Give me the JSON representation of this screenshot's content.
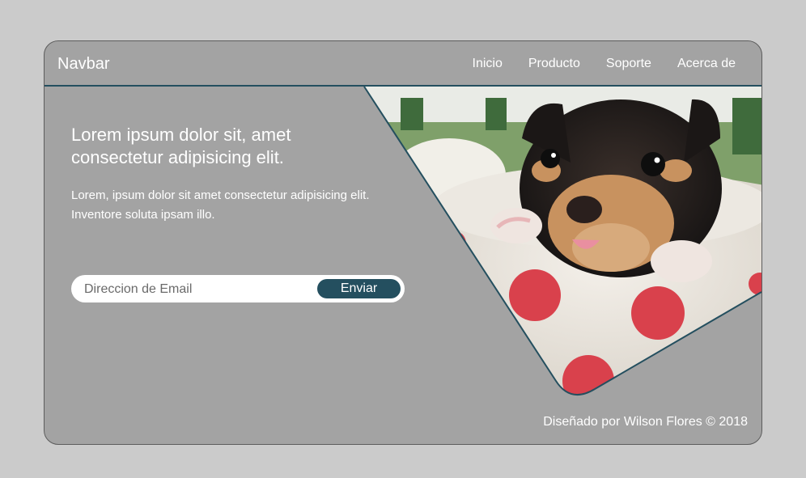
{
  "navbar": {
    "brand": "Navbar",
    "links": [
      "Inicio",
      "Producto",
      "Soporte",
      "Acerca de"
    ]
  },
  "hero": {
    "title": "Lorem ipsum dolor sit, amet consectetur adipisicing elit.",
    "text": "Lorem, ipsum dolor sit amet consectetur adipisicing elit. Inventore soluta ipsam illo."
  },
  "form": {
    "email_placeholder": "Direccion de Email",
    "email_value": "",
    "submit_label": "Enviar"
  },
  "footer": {
    "credit": "Diseñado por Wilson Flores © 2018"
  },
  "colors": {
    "background": "#cbcbcb",
    "card": "#a3a3a3",
    "accent": "#244f5f",
    "text": "#ffffff"
  },
  "icons": {
    "hero_image": "puppy-in-polka-dot-cup-photo"
  }
}
